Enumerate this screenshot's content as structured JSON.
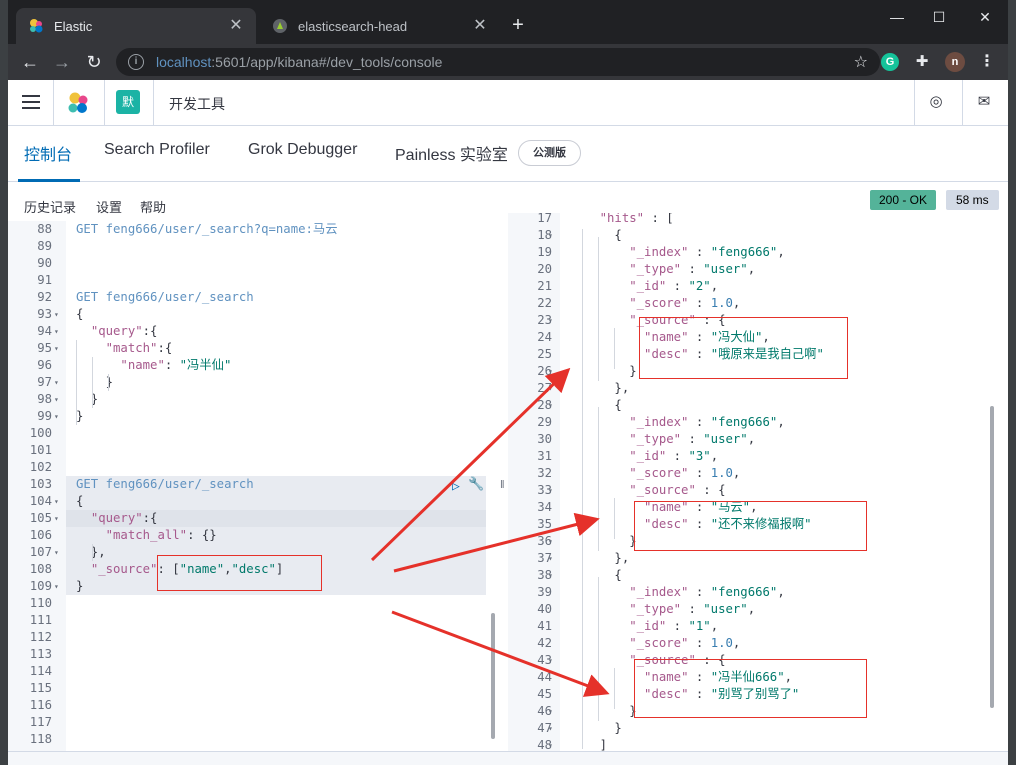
{
  "browser": {
    "tabs": [
      {
        "title": "Elastic",
        "close_glyph": "✕",
        "favicon": "elastic-logo"
      },
      {
        "title": "elasticsearch-head",
        "close_glyph": "✕",
        "favicon": "head-plugin-icon"
      }
    ],
    "new_tab_glyph": "+",
    "window_controls": {
      "minimize": "—",
      "maximize": "☐",
      "close": "✕"
    },
    "nav": {
      "back": "←",
      "forward": "→",
      "reload": "↻"
    },
    "address": {
      "host": "localhost",
      "rest": ":5601/app/kibana#/dev_tools/console"
    },
    "profile_initial": "n",
    "ext_grammarly": "G"
  },
  "kibana": {
    "space_avatar": "默",
    "breadcrumb": "开发工具",
    "tabs": [
      "控制台",
      "Search Profiler",
      "Grok Debugger",
      "Painless 实验室"
    ],
    "beta_badge": "公测版",
    "toolbar_links": [
      "历史记录",
      "设置",
      "帮助"
    ],
    "status": "200 - OK",
    "duration": "58 ms"
  },
  "editor": {
    "lines": [
      {
        "n": "88",
        "tokens": [
          [
            "method",
            "GET "
          ],
          [
            "url",
            "feng666/user/_search?q=name:马云"
          ]
        ]
      },
      {
        "n": "89",
        "tokens": []
      },
      {
        "n": "90",
        "tokens": []
      },
      {
        "n": "91",
        "tokens": []
      },
      {
        "n": "92",
        "tokens": [
          [
            "method",
            "GET "
          ],
          [
            "url",
            "feng666/user/_search"
          ]
        ]
      },
      {
        "n": "93",
        "fold": true,
        "tokens": [
          [
            "p",
            "{"
          ]
        ]
      },
      {
        "n": "94",
        "fold": true,
        "tokens": [
          [
            "p",
            "  "
          ],
          [
            "key",
            "\"query\""
          ],
          [
            "p",
            ":{"
          ]
        ]
      },
      {
        "n": "95",
        "fold": true,
        "tokens": [
          [
            "p",
            "    "
          ],
          [
            "key",
            "\"match\""
          ],
          [
            "p",
            ":{"
          ]
        ]
      },
      {
        "n": "96",
        "tokens": [
          [
            "p",
            "      "
          ],
          [
            "key",
            "\"name\""
          ],
          [
            "p",
            ": "
          ],
          [
            "str",
            "\"冯半仙\""
          ]
        ]
      },
      {
        "n": "97",
        "fold": true,
        "tokens": [
          [
            "p",
            "    }"
          ]
        ]
      },
      {
        "n": "98",
        "fold": true,
        "tokens": [
          [
            "p",
            "  }"
          ]
        ]
      },
      {
        "n": "99",
        "fold": true,
        "tokens": [
          [
            "p",
            "}"
          ]
        ]
      },
      {
        "n": "100",
        "tokens": []
      },
      {
        "n": "101",
        "tokens": []
      },
      {
        "n": "102",
        "tokens": []
      },
      {
        "n": "103",
        "tokens": [
          [
            "method",
            "GET "
          ],
          [
            "url",
            "feng666/user/_search"
          ]
        ],
        "hl": true
      },
      {
        "n": "104",
        "fold": true,
        "tokens": [
          [
            "p",
            "{"
          ]
        ],
        "hl": true
      },
      {
        "n": "105",
        "fold": true,
        "tokens": [
          [
            "p",
            "  "
          ],
          [
            "key",
            "\"query\""
          ],
          [
            "p",
            ":{"
          ]
        ],
        "hl": true,
        "cur": true
      },
      {
        "n": "106",
        "tokens": [
          [
            "p",
            "    "
          ],
          [
            "key",
            "\"match_all\""
          ],
          [
            "p",
            ": {}"
          ]
        ],
        "hl": true
      },
      {
        "n": "107",
        "fold": true,
        "tokens": [
          [
            "p",
            "  },"
          ]
        ],
        "hl": true
      },
      {
        "n": "108",
        "tokens": [
          [
            "p",
            "  "
          ],
          [
            "key",
            "\"_source\""
          ],
          [
            "p",
            ": ["
          ],
          [
            "str",
            "\"name\""
          ],
          [
            "p",
            ","
          ],
          [
            "str",
            "\"desc\""
          ],
          [
            "p",
            "]"
          ]
        ],
        "hl": true
      },
      {
        "n": "109",
        "fold": true,
        "tokens": [
          [
            "p",
            "}"
          ]
        ],
        "hl": true
      },
      {
        "n": "110",
        "tokens": []
      },
      {
        "n": "111",
        "tokens": []
      },
      {
        "n": "112",
        "tokens": []
      },
      {
        "n": "113",
        "tokens": []
      },
      {
        "n": "114",
        "tokens": []
      },
      {
        "n": "115",
        "tokens": []
      },
      {
        "n": "116",
        "tokens": []
      },
      {
        "n": "117",
        "tokens": []
      },
      {
        "n": "118",
        "tokens": []
      }
    ],
    "action_icons": [
      "▷",
      "🔧"
    ]
  },
  "output": {
    "lines": [
      {
        "n": "17",
        "tokens": [
          [
            "p",
            "    "
          ],
          [
            "key",
            "\"hits\""
          ],
          [
            "p",
            " : ["
          ]
        ]
      },
      {
        "n": "18",
        "fold": true,
        "tokens": [
          [
            "p",
            "      {"
          ]
        ]
      },
      {
        "n": "19",
        "tokens": [
          [
            "p",
            "        "
          ],
          [
            "key",
            "\"_index\""
          ],
          [
            "p",
            " : "
          ],
          [
            "str",
            "\"feng666\""
          ],
          [
            "p",
            ","
          ]
        ]
      },
      {
        "n": "20",
        "tokens": [
          [
            "p",
            "        "
          ],
          [
            "key",
            "\"_type\""
          ],
          [
            "p",
            " : "
          ],
          [
            "str",
            "\"user\""
          ],
          [
            "p",
            ","
          ]
        ]
      },
      {
        "n": "21",
        "tokens": [
          [
            "p",
            "        "
          ],
          [
            "key",
            "\"_id\""
          ],
          [
            "p",
            " : "
          ],
          [
            "str",
            "\"2\""
          ],
          [
            "p",
            ","
          ]
        ]
      },
      {
        "n": "22",
        "tokens": [
          [
            "p",
            "        "
          ],
          [
            "key",
            "\"_score\""
          ],
          [
            "p",
            " : "
          ],
          [
            "num",
            "1.0"
          ],
          [
            "p",
            ","
          ]
        ]
      },
      {
        "n": "23",
        "fold": true,
        "tokens": [
          [
            "p",
            "        "
          ],
          [
            "key",
            "\"_source\""
          ],
          [
            "p",
            " : {"
          ]
        ]
      },
      {
        "n": "24",
        "tokens": [
          [
            "p",
            "          "
          ],
          [
            "key",
            "\"name\""
          ],
          [
            "p",
            " : "
          ],
          [
            "str",
            "\"冯大仙\""
          ],
          [
            "p",
            ","
          ]
        ]
      },
      {
        "n": "25",
        "tokens": [
          [
            "p",
            "          "
          ],
          [
            "key",
            "\"desc\""
          ],
          [
            "p",
            " : "
          ],
          [
            "str",
            "\"哦原来是我自己啊\""
          ]
        ]
      },
      {
        "n": "26",
        "fold": true,
        "tokens": [
          [
            "p",
            "        }"
          ]
        ]
      },
      {
        "n": "27",
        "fold": true,
        "tokens": [
          [
            "p",
            "      },"
          ]
        ]
      },
      {
        "n": "28",
        "fold": true,
        "tokens": [
          [
            "p",
            "      {"
          ]
        ]
      },
      {
        "n": "29",
        "tokens": [
          [
            "p",
            "        "
          ],
          [
            "key",
            "\"_index\""
          ],
          [
            "p",
            " : "
          ],
          [
            "str",
            "\"feng666\""
          ],
          [
            "p",
            ","
          ]
        ]
      },
      {
        "n": "30",
        "tokens": [
          [
            "p",
            "        "
          ],
          [
            "key",
            "\"_type\""
          ],
          [
            "p",
            " : "
          ],
          [
            "str",
            "\"user\""
          ],
          [
            "p",
            ","
          ]
        ]
      },
      {
        "n": "31",
        "tokens": [
          [
            "p",
            "        "
          ],
          [
            "key",
            "\"_id\""
          ],
          [
            "p",
            " : "
          ],
          [
            "str",
            "\"3\""
          ],
          [
            "p",
            ","
          ]
        ]
      },
      {
        "n": "32",
        "tokens": [
          [
            "p",
            "        "
          ],
          [
            "key",
            "\"_score\""
          ],
          [
            "p",
            " : "
          ],
          [
            "num",
            "1.0"
          ],
          [
            "p",
            ","
          ]
        ]
      },
      {
        "n": "33",
        "fold": true,
        "tokens": [
          [
            "p",
            "        "
          ],
          [
            "key",
            "\"_source\""
          ],
          [
            "p",
            " : {"
          ]
        ]
      },
      {
        "n": "34",
        "tokens": [
          [
            "p",
            "          "
          ],
          [
            "key",
            "\"name\""
          ],
          [
            "p",
            " : "
          ],
          [
            "str",
            "\"马云\""
          ],
          [
            "p",
            ","
          ]
        ]
      },
      {
        "n": "35",
        "tokens": [
          [
            "p",
            "          "
          ],
          [
            "key",
            "\"desc\""
          ],
          [
            "p",
            " : "
          ],
          [
            "str",
            "\"还不来修福报啊\""
          ]
        ]
      },
      {
        "n": "36",
        "fold": true,
        "tokens": [
          [
            "p",
            "        }"
          ]
        ]
      },
      {
        "n": "37",
        "fold": true,
        "tokens": [
          [
            "p",
            "      },"
          ]
        ]
      },
      {
        "n": "38",
        "fold": true,
        "tokens": [
          [
            "p",
            "      {"
          ]
        ]
      },
      {
        "n": "39",
        "tokens": [
          [
            "p",
            "        "
          ],
          [
            "key",
            "\"_index\""
          ],
          [
            "p",
            " : "
          ],
          [
            "str",
            "\"feng666\""
          ],
          [
            "p",
            ","
          ]
        ]
      },
      {
        "n": "40",
        "tokens": [
          [
            "p",
            "        "
          ],
          [
            "key",
            "\"_type\""
          ],
          [
            "p",
            " : "
          ],
          [
            "str",
            "\"user\""
          ],
          [
            "p",
            ","
          ]
        ]
      },
      {
        "n": "41",
        "tokens": [
          [
            "p",
            "        "
          ],
          [
            "key",
            "\"_id\""
          ],
          [
            "p",
            " : "
          ],
          [
            "str",
            "\"1\""
          ],
          [
            "p",
            ","
          ]
        ]
      },
      {
        "n": "42",
        "tokens": [
          [
            "p",
            "        "
          ],
          [
            "key",
            "\"_score\""
          ],
          [
            "p",
            " : "
          ],
          [
            "num",
            "1.0"
          ],
          [
            "p",
            ","
          ]
        ]
      },
      {
        "n": "43",
        "fold": true,
        "tokens": [
          [
            "p",
            "        "
          ],
          [
            "key",
            "\"_source\""
          ],
          [
            "p",
            " : {"
          ]
        ]
      },
      {
        "n": "44",
        "tokens": [
          [
            "p",
            "          "
          ],
          [
            "key",
            "\"name\""
          ],
          [
            "p",
            " : "
          ],
          [
            "str",
            "\"冯半仙666\""
          ],
          [
            "p",
            ","
          ]
        ]
      },
      {
        "n": "45",
        "tokens": [
          [
            "p",
            "          "
          ],
          [
            "key",
            "\"desc\""
          ],
          [
            "p",
            " : "
          ],
          [
            "str",
            "\"别骂了别骂了\""
          ]
        ]
      },
      {
        "n": "46",
        "fold": true,
        "tokens": [
          [
            "p",
            "        }"
          ]
        ]
      },
      {
        "n": "47",
        "fold": true,
        "tokens": [
          [
            "p",
            "      }"
          ]
        ]
      },
      {
        "n": "48",
        "fold": true,
        "tokens": [
          [
            "p",
            "    ]"
          ]
        ]
      }
    ]
  },
  "annotation_color": "#e5312a"
}
